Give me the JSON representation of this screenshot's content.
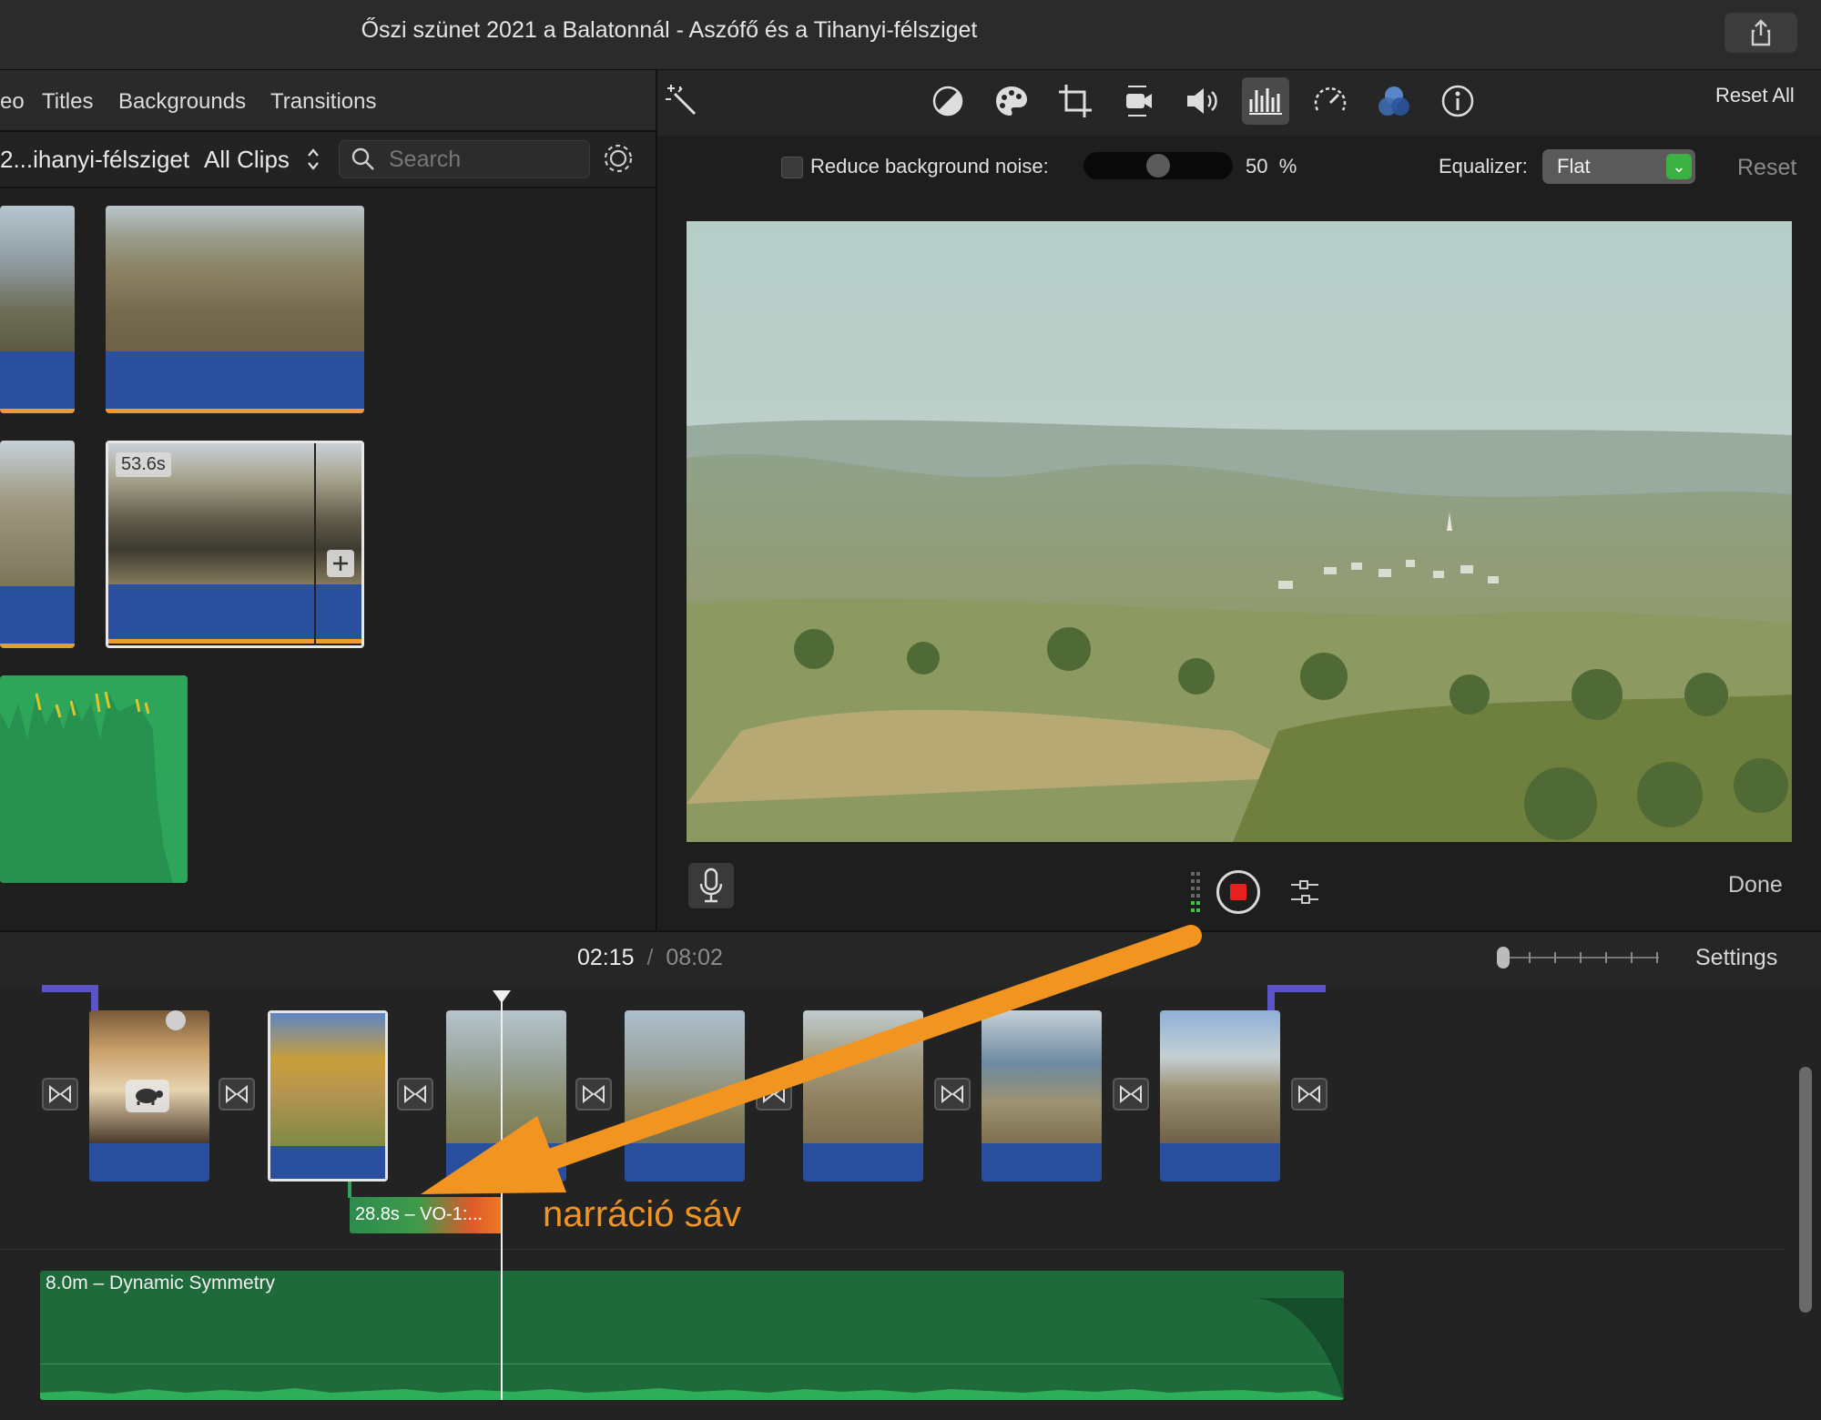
{
  "window": {
    "title": "Őszi szünet 2021 a Balatonnál - Aszófő és a Tihanyi-félsziget"
  },
  "library": {
    "tabs": [
      "eo",
      "Titles",
      "Backgrounds",
      "Transitions"
    ],
    "event_name": "2...ihanyi-félsziget",
    "filter": "All Clips",
    "search_placeholder": "Search",
    "selected_clip_duration": "53.6s"
  },
  "inspector": {
    "reset_all": "Reset All",
    "noise_label": "Reduce background noise:",
    "noise_value": "50",
    "noise_unit": "%",
    "noise_fraction": 0.5,
    "equalizer_label": "Equalizer:",
    "equalizer_value": "Flat",
    "reset": "Reset",
    "done": "Done",
    "icons": [
      "magic-wand-icon",
      "color-balance-icon",
      "color-palette-icon",
      "crop-icon",
      "stabilization-icon",
      "volume-icon",
      "audio-equalizer-icon",
      "speed-icon",
      "clip-filter-icon",
      "info-icon"
    ]
  },
  "timeline": {
    "current_time": "02:15",
    "separator": "/",
    "total_time": "08:02",
    "settings": "Settings",
    "voiceover_clip": "28.8s – VO-1:...",
    "annotation": "narráció sáv",
    "music_clip": "8.0m – Dynamic Symmetry"
  },
  "colors": {
    "accent_orange": "#f29520",
    "audio_blue": "#2a4f9e",
    "music_green": "#1f6a3a",
    "record_red": "#e8201e"
  }
}
